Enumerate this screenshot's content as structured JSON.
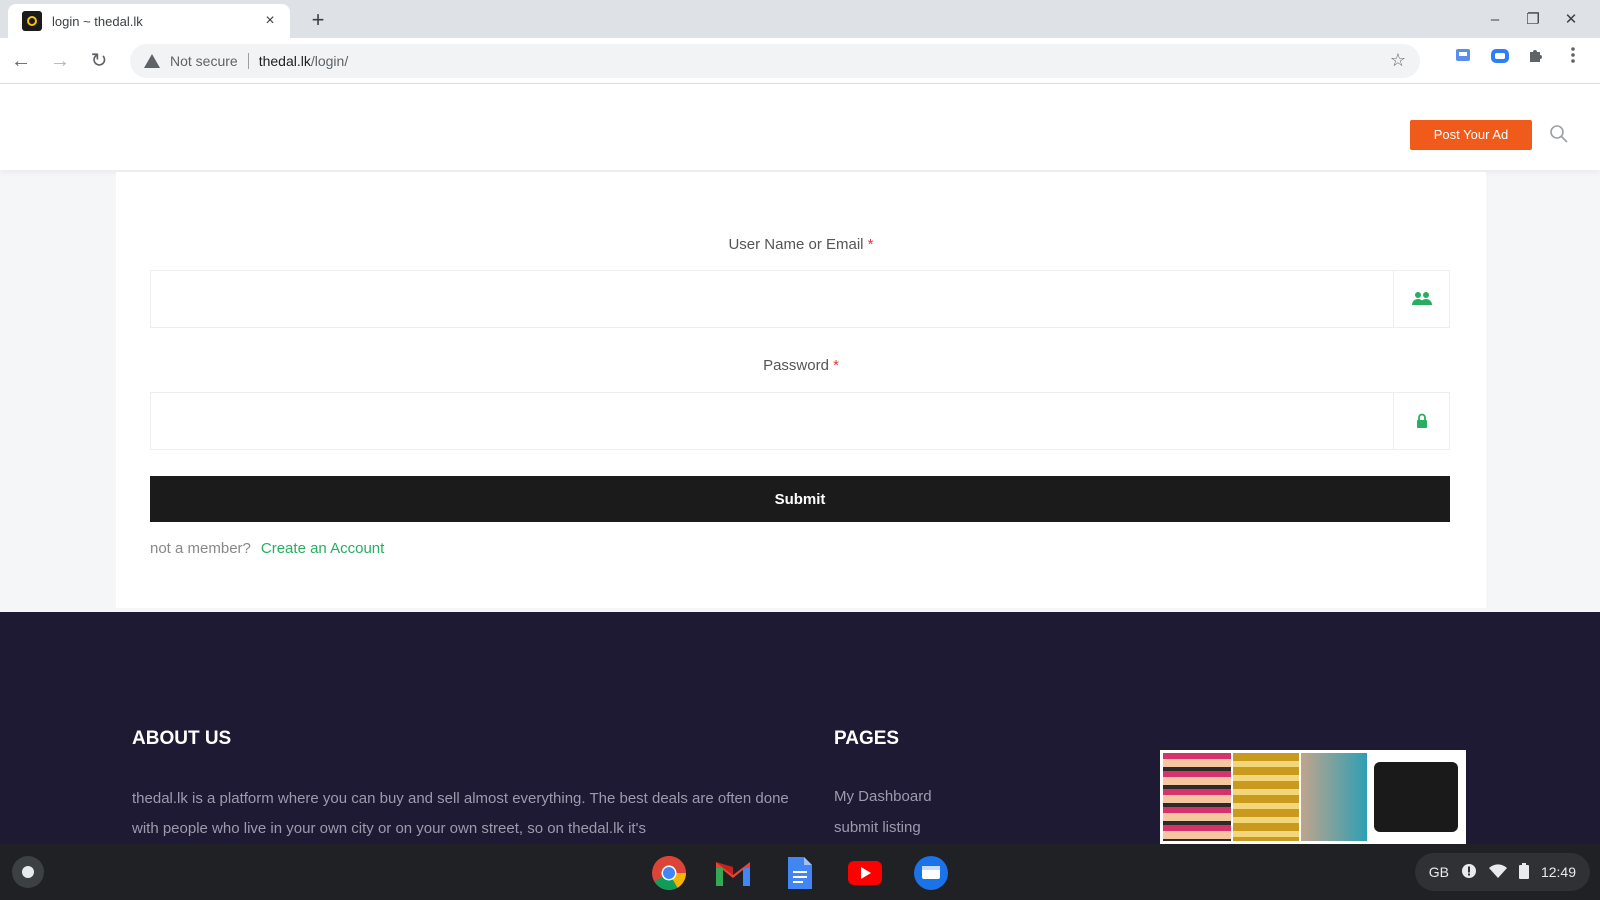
{
  "browser": {
    "tab_title": "login ~ thedal.lk",
    "tab_close": "×",
    "new_tab": "+",
    "window_controls": {
      "minimize": "–",
      "maximize": "❐",
      "close": "✕"
    },
    "nav": {
      "back": "←",
      "forward": "→",
      "reload": "↻"
    },
    "omnibox": {
      "security": "Not secure",
      "host": "thedal.lk",
      "path": "/login/"
    },
    "star": "☆"
  },
  "header": {
    "post_ad_label": "Post Your Ad"
  },
  "login": {
    "username_label": "User Name or Email",
    "password_label": "Password",
    "required_mark": "*",
    "submit_label": "Submit",
    "not_member": "not a member?",
    "create_account": "Create an Account"
  },
  "footer": {
    "about_title": "ABOUT US",
    "about_text": "thedal.lk is a platform where you can buy and sell almost everything. The best deals are often done with people who live in your own city or on your own street, so on thedal.lk it's",
    "pages_title": "PAGES",
    "pages": [
      "My Dashboard",
      "submit listing"
    ]
  },
  "shelf": {
    "tray": {
      "locale": "GB",
      "time": "12:49"
    }
  },
  "colors": {
    "accent_orange": "#f05a1a",
    "link_green": "#27ae60",
    "footer_bg": "#1f1a33",
    "submit_bg": "#1b1b1b"
  }
}
